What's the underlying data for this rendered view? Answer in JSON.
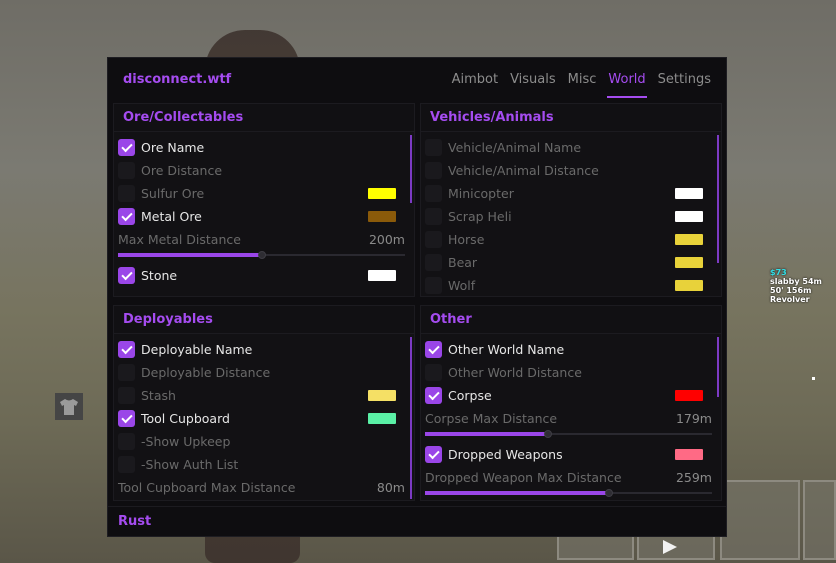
{
  "window": {
    "brand": "disconnect.wtf",
    "footer": "Rust"
  },
  "tabs": [
    {
      "label": "Aimbot",
      "active": false
    },
    {
      "label": "Visuals",
      "active": false
    },
    {
      "label": "Misc",
      "active": false
    },
    {
      "label": "World",
      "active": true
    },
    {
      "label": "Settings",
      "active": false
    }
  ],
  "ore_panel": {
    "title": "Ore/Collectables",
    "ore_name": {
      "label": "Ore Name",
      "checked": true
    },
    "ore_distance": {
      "label": "Ore Distance",
      "checked": false
    },
    "sulfur_ore": {
      "label": "Sulfur Ore",
      "checked": false,
      "color": "#ffff00"
    },
    "metal_ore": {
      "label": "Metal Ore",
      "checked": true,
      "color": "#8a5a0a"
    },
    "max_metal_distance": {
      "label": "Max Metal Distance",
      "value": "200m",
      "fraction": 0.5
    },
    "stone": {
      "label": "Stone",
      "checked": true,
      "color": "#ffffff"
    }
  },
  "vehicles_panel": {
    "title": "Vehicles/Animals",
    "name": {
      "label": "Vehicle/Animal Name",
      "checked": false
    },
    "distance": {
      "label": "Vehicle/Animal Distance",
      "checked": false
    },
    "minicopter": {
      "label": "Minicopter",
      "checked": false,
      "color": "#ffffff"
    },
    "scrap_heli": {
      "label": "Scrap Heli",
      "checked": false,
      "color": "#ffffff"
    },
    "horse": {
      "label": "Horse",
      "checked": false,
      "color": "#e8d23a"
    },
    "bear": {
      "label": "Bear",
      "checked": false,
      "color": "#e8d23a"
    },
    "wolf": {
      "label": "Wolf",
      "checked": false,
      "color": "#e8d23a"
    }
  },
  "deployables_panel": {
    "title": "Deployables",
    "name": {
      "label": "Deployable Name",
      "checked": true
    },
    "distance": {
      "label": "Deployable Distance",
      "checked": false
    },
    "stash": {
      "label": "Stash",
      "checked": false,
      "color": "#f5e065"
    },
    "tool_cupboard": {
      "label": "Tool Cupboard",
      "checked": true,
      "color": "#5af0a6"
    },
    "show_upkeep": {
      "label": "-Show Upkeep",
      "checked": false
    },
    "show_auth_list": {
      "label": "-Show Auth List",
      "checked": false
    },
    "tc_max_distance": {
      "label": "Tool Cupboard Max Distance",
      "value": "80m"
    }
  },
  "other_panel": {
    "title": "Other",
    "world_name": {
      "label": "Other World Name",
      "checked": true
    },
    "world_distance": {
      "label": "Other World Distance",
      "checked": false
    },
    "corpse": {
      "label": "Corpse",
      "checked": true,
      "color": "#ff0000"
    },
    "corpse_max_distance": {
      "label": "Corpse Max Distance",
      "value": "179m",
      "fraction": 0.43
    },
    "dropped_weapons": {
      "label": "Dropped Weapons",
      "checked": true,
      "color": "#ff6a85"
    },
    "dropped_weapon_max_distance": {
      "label": "Dropped Weapon Max Distance",
      "value": "259m",
      "fraction": 0.64
    }
  },
  "esp_overlay": {
    "name": "slabby",
    "tag": "$73",
    "line1_dist": "54m",
    "line2": "50' 156m",
    "weapon": "Revolver"
  }
}
